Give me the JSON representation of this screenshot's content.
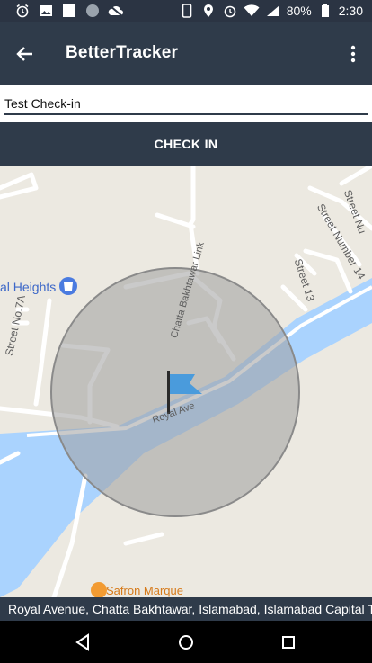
{
  "status_bar": {
    "battery": "80%",
    "time": "2:30"
  },
  "app_bar": {
    "title": "BetterTracker"
  },
  "checkin_field": {
    "value": "Test Check-in"
  },
  "checkin_button": {
    "label": "CHECK IN"
  },
  "map": {
    "place_label": "al Heights",
    "poi_label": "Safron Marque",
    "streets": {
      "street_7a": "Street No.7A",
      "chatta_link": "Chatta Bakhtawar Link",
      "royal": "Royal Ave",
      "street_13": "Street 13",
      "street_14": "Street Number 14",
      "street_nu": "Street Nu"
    }
  },
  "address_bar": {
    "text": "Royal Avenue, Chatta Bakhtawar, Islamabad, Islamabad Capital Territory, Pakistan"
  },
  "colors": {
    "appbar": "#2f3b4a",
    "water": "#aad3fe",
    "flag": "#4a9bdc",
    "radius_circle": "#9e9e9e"
  }
}
